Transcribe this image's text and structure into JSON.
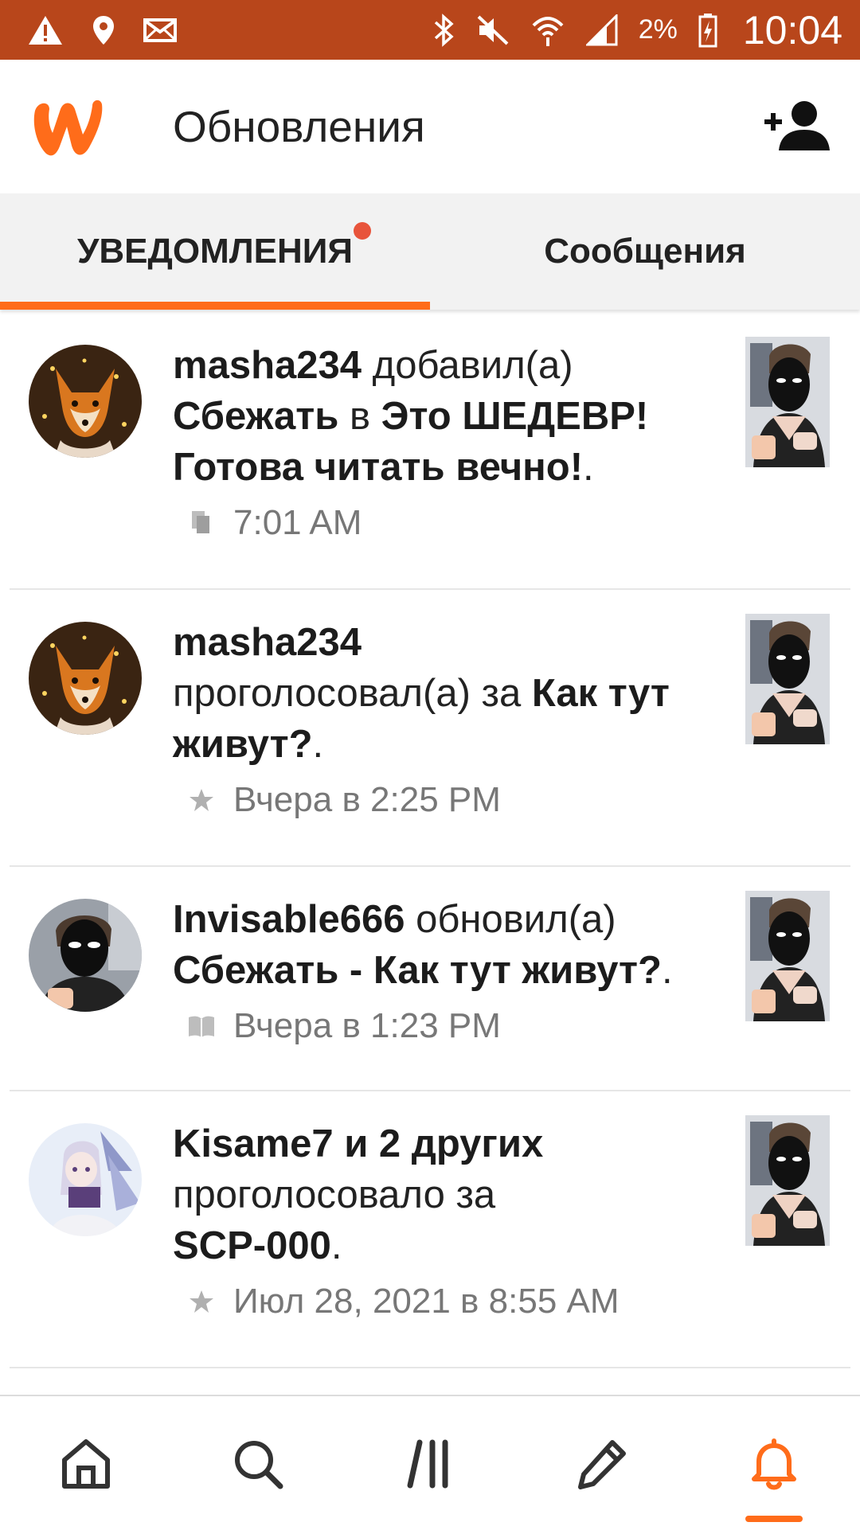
{
  "status_bar": {
    "battery_percent": "2%",
    "time": "10:04",
    "icons": [
      "warning-icon",
      "location-icon",
      "mail-icon",
      "bluetooth-icon",
      "mute-icon",
      "wifi-icon",
      "signal-icon",
      "battery-charging-icon"
    ]
  },
  "app_bar": {
    "title": "Обновления",
    "logo": "wattpad-logo",
    "action_icon": "add-user-icon"
  },
  "tabs": [
    {
      "label": "УВЕДОМЛЕНИЯ",
      "active": true,
      "has_badge": true
    },
    {
      "label": "Сообщения",
      "active": false,
      "has_badge": false
    }
  ],
  "colors": {
    "status_bar": "#b8461b",
    "accent": "#ff6c1a",
    "badge": "#e8543b"
  },
  "notifications": [
    {
      "user": "masha234",
      "action": " добавил(а) ",
      "story": "Сбежать",
      "middle": " в ",
      "target": "Это ШЕДЕВР! Готова читать вечно!",
      "end": ".",
      "meta_icon": "reading-list-icon",
      "time": "7:01 AM"
    },
    {
      "user": "masha234",
      "action": "проголосовал(а) за ",
      "story": "Как тут живут?",
      "end": ".",
      "meta_icon": "star-icon",
      "time": "Вчера в 2:25 PM"
    },
    {
      "user": "Invisable666",
      "action": " обновил(а) ",
      "story": "Сбежать - Как тут живут?",
      "end": ".",
      "meta_icon": "book-icon",
      "time": "Вчера в 1:23 PM"
    },
    {
      "user": "Kisame7 и 2 других",
      "action": "проголосовало за ",
      "story": "SCP-000",
      "end": ".",
      "meta_icon": "star-icon",
      "time": "Июл 28, 2021 в 8:55 AM"
    }
  ],
  "bottom_nav": [
    {
      "icon": "home-icon",
      "active": false
    },
    {
      "icon": "search-icon",
      "active": false
    },
    {
      "icon": "library-icon",
      "active": false
    },
    {
      "icon": "pencil-icon",
      "active": false
    },
    {
      "icon": "bell-icon",
      "active": true
    }
  ]
}
